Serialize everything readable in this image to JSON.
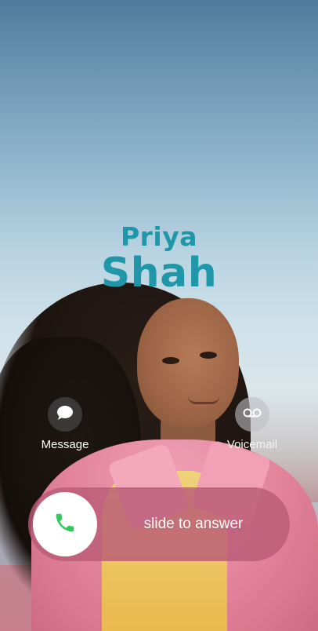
{
  "caller": {
    "first_name": "Priya",
    "last_name": "Shah"
  },
  "actions": {
    "message": {
      "label": "Message",
      "icon": "speech-bubble-icon"
    },
    "voicemail": {
      "label": "Voicemail",
      "icon": "voicemail-icon"
    }
  },
  "answer": {
    "label": "slide to answer",
    "icon": "phone-icon",
    "accent": "#34c759"
  },
  "colors": {
    "name": "#1f97a8",
    "slider": "#ba5c76"
  }
}
